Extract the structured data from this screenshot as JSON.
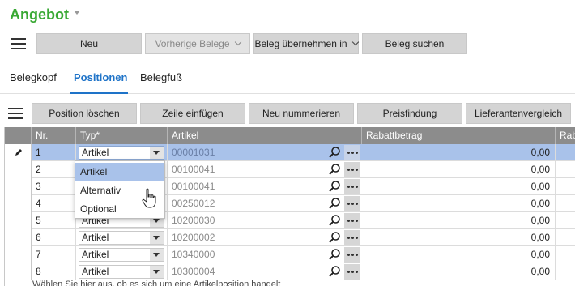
{
  "page": {
    "title": "Angebot"
  },
  "toolbar": {
    "buttons": [
      {
        "label": "Neu"
      },
      {
        "label": "Vorherige Belege"
      },
      {
        "label": "Beleg übernehmen in"
      },
      {
        "label": "Beleg suchen"
      }
    ]
  },
  "tabs": [
    {
      "label": "Belegkopf"
    },
    {
      "label": "Positionen"
    },
    {
      "label": "Belegfuß"
    }
  ],
  "actions": {
    "buttons": [
      {
        "label": "Position löschen"
      },
      {
        "label": "Zeile einfügen"
      },
      {
        "label": "Neu nummerieren"
      },
      {
        "label": "Preisfindung"
      },
      {
        "label": "Lieferantenvergleich"
      }
    ]
  },
  "grid": {
    "columns": [
      "Nr.",
      "Typ*",
      "Artikel",
      "Rabattbetrag",
      "Raba"
    ],
    "rows": [
      {
        "nr": "1",
        "typ": "Artikel",
        "artikel": "00001031",
        "rabatt": "0,00"
      },
      {
        "nr": "2",
        "typ": "",
        "artikel": "00100041",
        "rabatt": "0,00"
      },
      {
        "nr": "3",
        "typ": "",
        "artikel": "00100041",
        "rabatt": "0,00"
      },
      {
        "nr": "4",
        "typ": "",
        "artikel": "00250012",
        "rabatt": "0,00"
      },
      {
        "nr": "5",
        "typ": "Artikel",
        "artikel": "10200030",
        "rabatt": "0,00"
      },
      {
        "nr": "6",
        "typ": "Artikel",
        "artikel": "10200002",
        "rabatt": "0,00"
      },
      {
        "nr": "7",
        "typ": "Artikel",
        "artikel": "10340000",
        "rabatt": "0,00"
      },
      {
        "nr": "8",
        "typ": "Artikel",
        "artikel": "10300004",
        "rabatt": "0,00"
      }
    ]
  },
  "dropdown": {
    "options": [
      "Artikel",
      "Alternativ",
      "Optional"
    ],
    "highlighted": "Artikel"
  },
  "status": {
    "text": "Wählen Sie hier aus, ob es sich um eine Artikelposition handelt"
  },
  "colors": {
    "accent": "#1e73c8",
    "title": "#3aa935",
    "selection": "#a9c2ea",
    "header": "#8c8c8c"
  },
  "icons": [
    "hamburger-menu-icon",
    "search-icon",
    "more-icon",
    "pencil-icon",
    "hand-cursor-icon"
  ]
}
